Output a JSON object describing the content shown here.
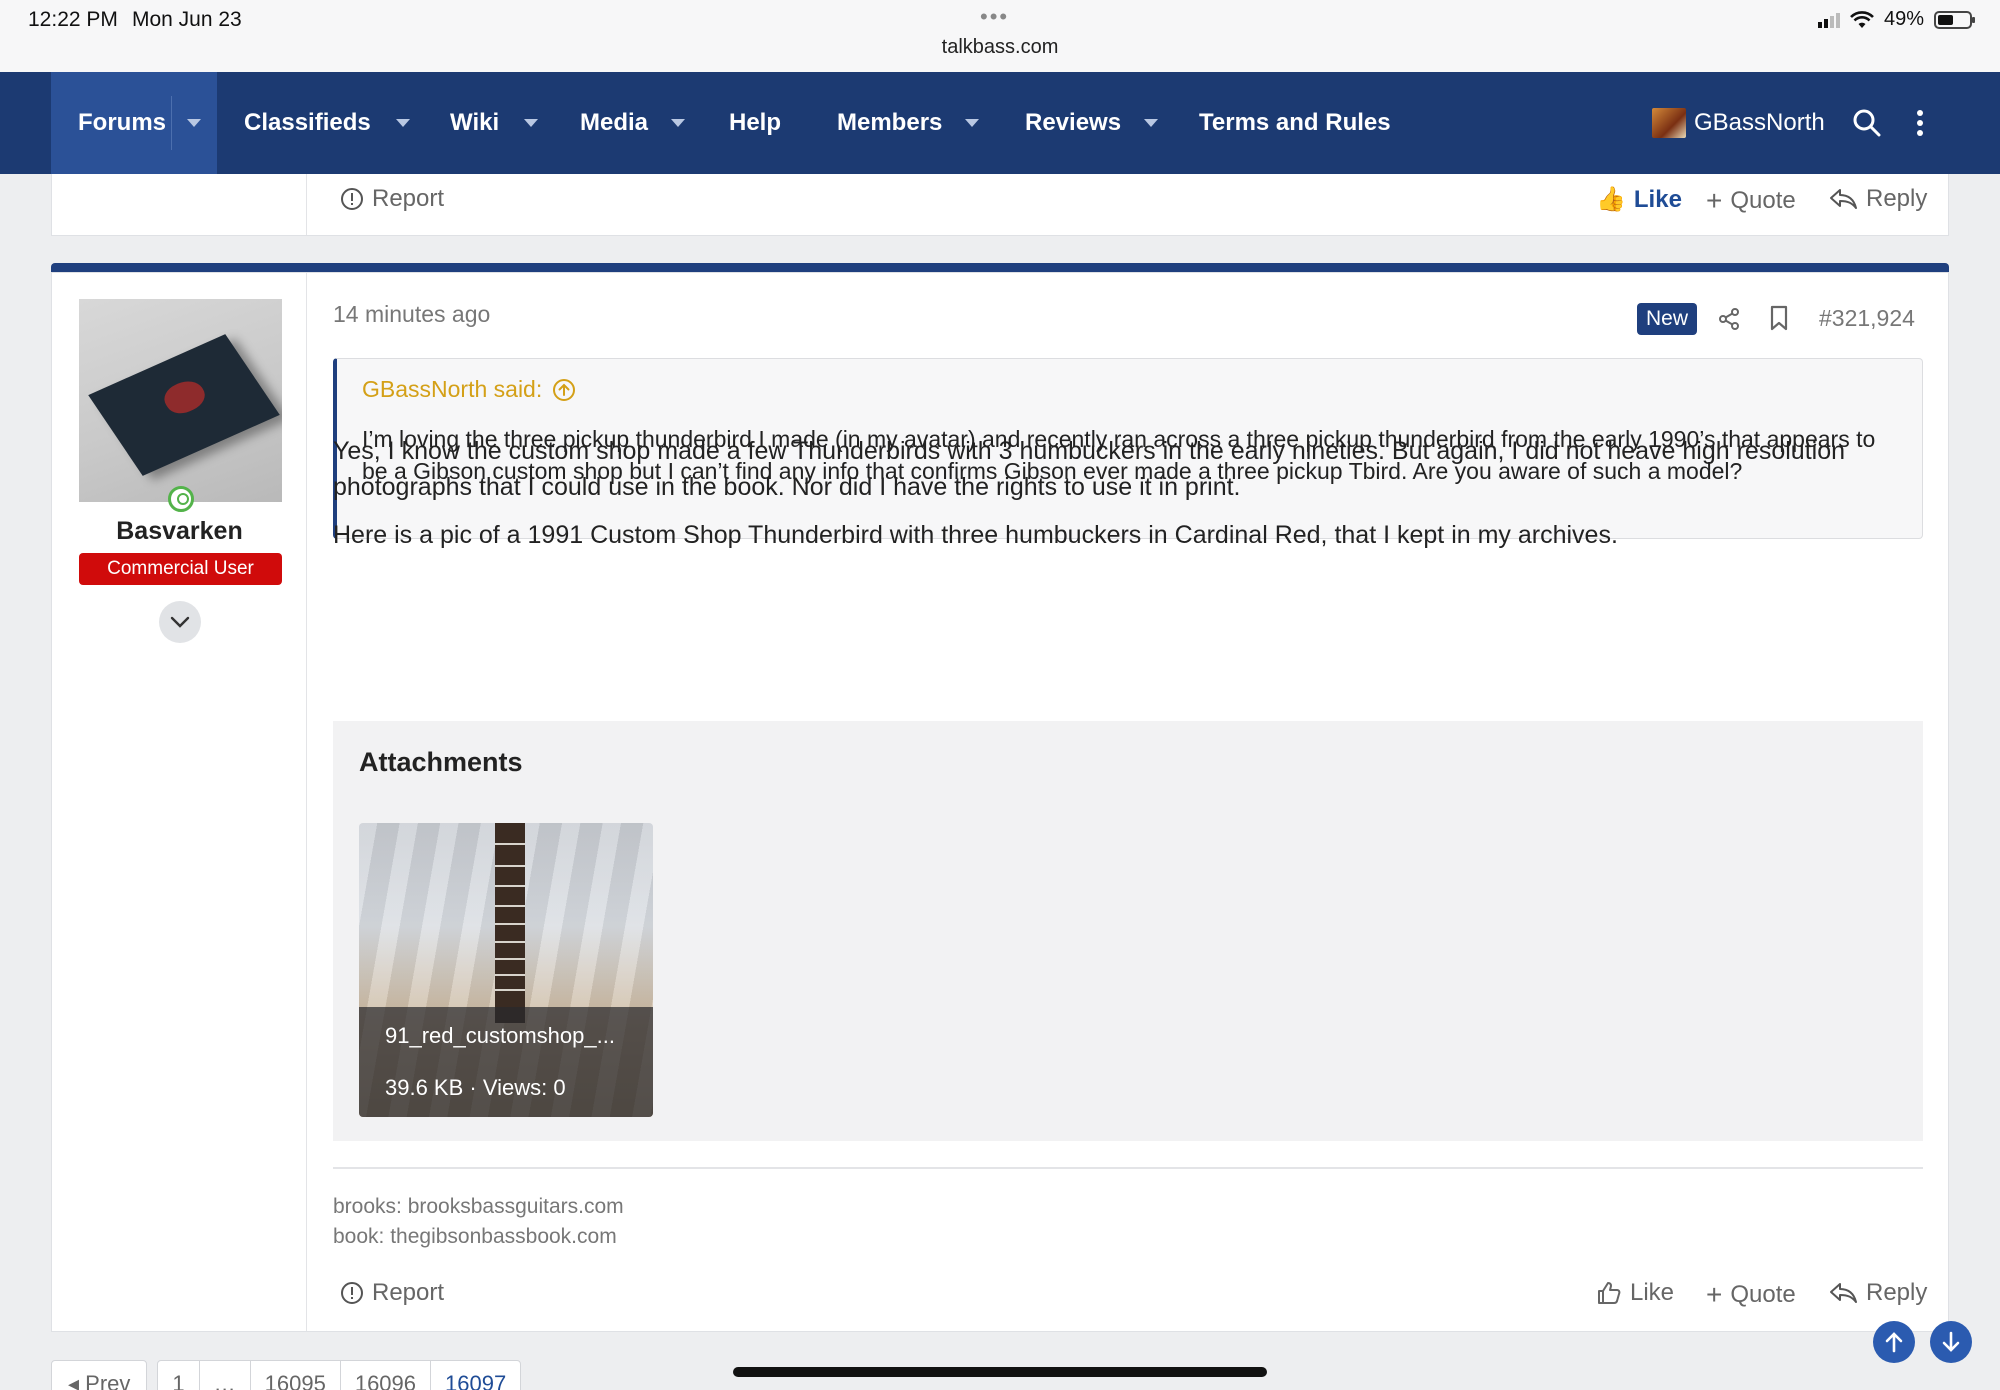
{
  "status_bar": {
    "time": "12:22 PM",
    "date": "Mon Jun 23",
    "url": "talkbass.com",
    "battery": "49%",
    "battery_level": 0.49
  },
  "nav": {
    "items": [
      {
        "label": "Forums",
        "has_menu": true,
        "active": true
      },
      {
        "label": "Classifieds",
        "has_menu": true
      },
      {
        "label": "Wiki",
        "has_menu": true
      },
      {
        "label": "Media",
        "has_menu": true
      },
      {
        "label": "Help",
        "has_menu": false
      },
      {
        "label": "Members",
        "has_menu": true
      },
      {
        "label": "Reviews",
        "has_menu": true
      },
      {
        "label": "Terms and Rules",
        "has_menu": false
      }
    ],
    "username": "GBassNorth",
    "search_icon": "search-icon",
    "more_icon": "vertical-ellipsis-icon"
  },
  "prev_post": {
    "report": "Report",
    "like": "Like",
    "quote": "Quote",
    "reply": "Reply"
  },
  "post": {
    "author": "Basvarken",
    "user_title": "Commercial User",
    "time_ago": "14 minutes ago",
    "new_badge": "New",
    "post_number": "#321,924",
    "quote": {
      "attribution": "GBassNorth said:",
      "text": "I’m loving the three pickup thunderbird I made (in my avatar) and recently ran across a three pickup thunderbird from the early 1990’s that appears to be a Gibson custom shop but I can’t find any info that confirms Gibson ever made a three pickup Tbird. Are you aware of such a model?"
    },
    "body": [
      "Yes, I know the custom shop made a few Thunderbirds with 3 humbuckers in the early nineties. But again, I did not heave high resolution photographs that I could use in the book. Nor did I have the rights to use it in print.",
      "Here is a pic of a 1991 Custom Shop Thunderbird with three humbuckers in Cardinal Red, that I kept in my archives."
    ],
    "attachments": {
      "title": "Attachments",
      "items": [
        {
          "name": "91_red_customshop_...",
          "meta": "39.6 KB · Views: 0"
        }
      ]
    },
    "signature": [
      "brooks: brooksbassguitars.com",
      "book: thegibsonbassbook.com"
    ],
    "actions": {
      "report": "Report",
      "like": "Like",
      "quote": "Quote",
      "reply": "Reply"
    }
  },
  "pagination": {
    "prev": "◂ Prev",
    "pages": [
      "1",
      "…",
      "16095",
      "16096",
      "16097"
    ]
  },
  "colors": {
    "nav_bg": "#1c3a72",
    "accent": "#1f3f7e",
    "user_title_bg": "#d00b0b",
    "quote_attr": "#d4a017"
  }
}
